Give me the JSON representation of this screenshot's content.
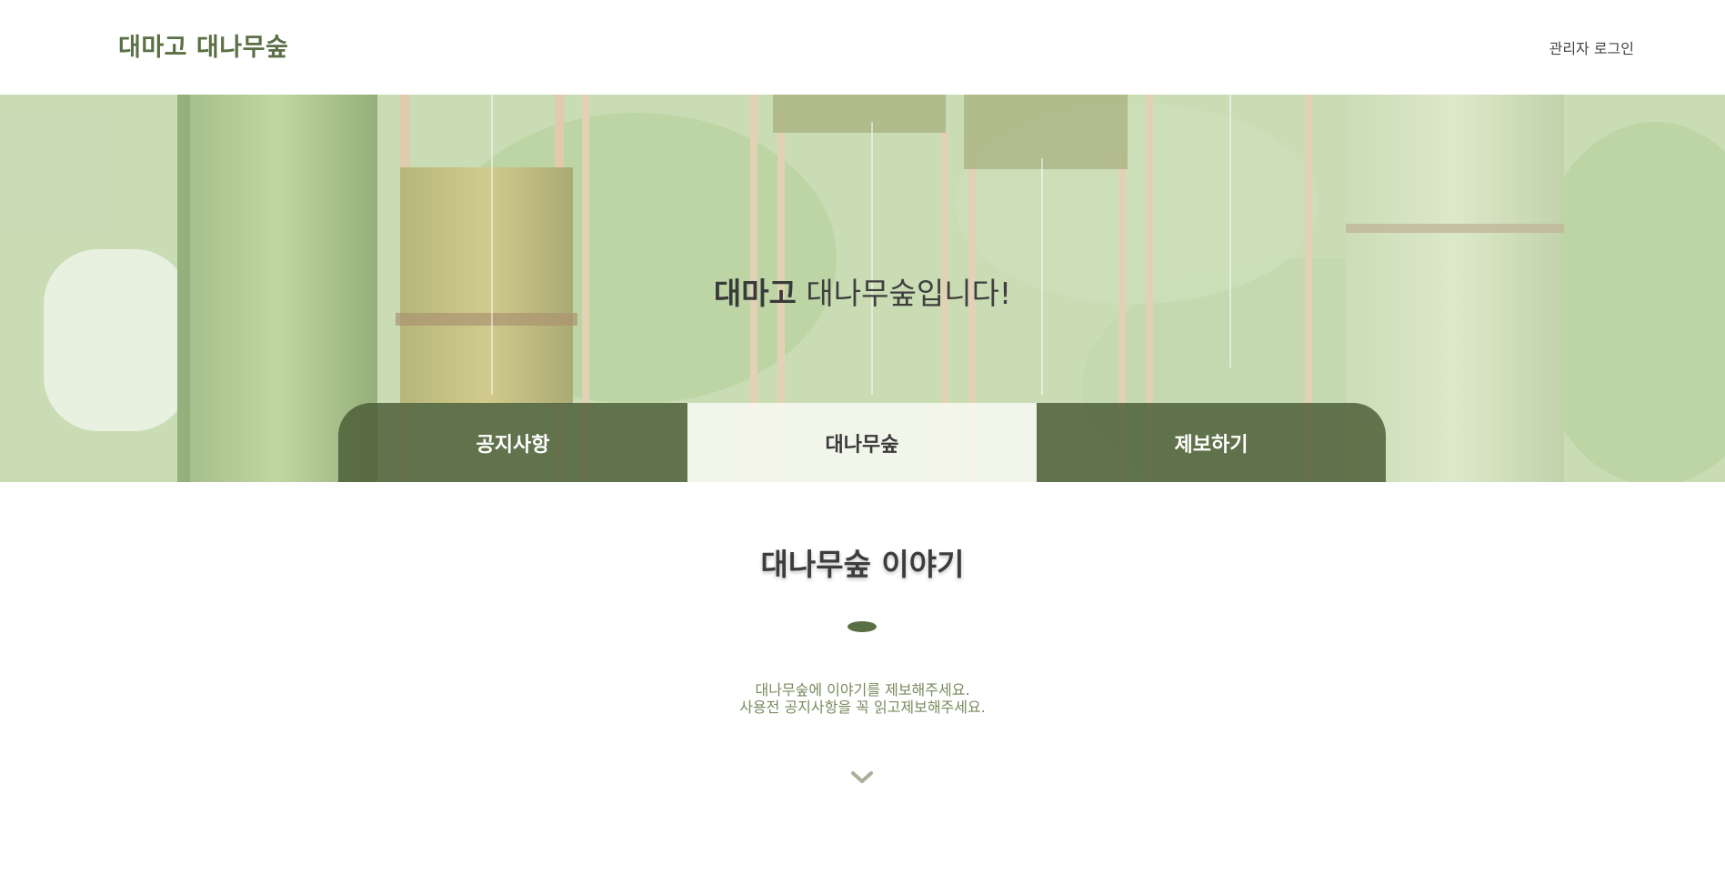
{
  "header": {
    "brand": "대마고 대나무숲",
    "admin_login": "관리자 로그인"
  },
  "hero": {
    "title_bold": "대마고",
    "title_rest": " 대나무숲입니다!"
  },
  "tabs": [
    {
      "label": "공지사항",
      "active": false
    },
    {
      "label": "대나무숲",
      "active": true
    },
    {
      "label": "제보하기",
      "active": false
    }
  ],
  "section": {
    "title": "대나무숲 이야기",
    "line1": "대나무숲에 이야기를 제보해주세요.",
    "line2": "사용전 공지사항을 꼭 읽고제보해주세요."
  },
  "icons": {
    "scroll_down": "chevron-down-icon"
  },
  "colors": {
    "brand": "#5b6f45",
    "tab_dark": "#4a5c34",
    "tab_active": "#f6f8f0",
    "desc_text": "#7a8a5e",
    "chevron": "#a7b09a"
  }
}
